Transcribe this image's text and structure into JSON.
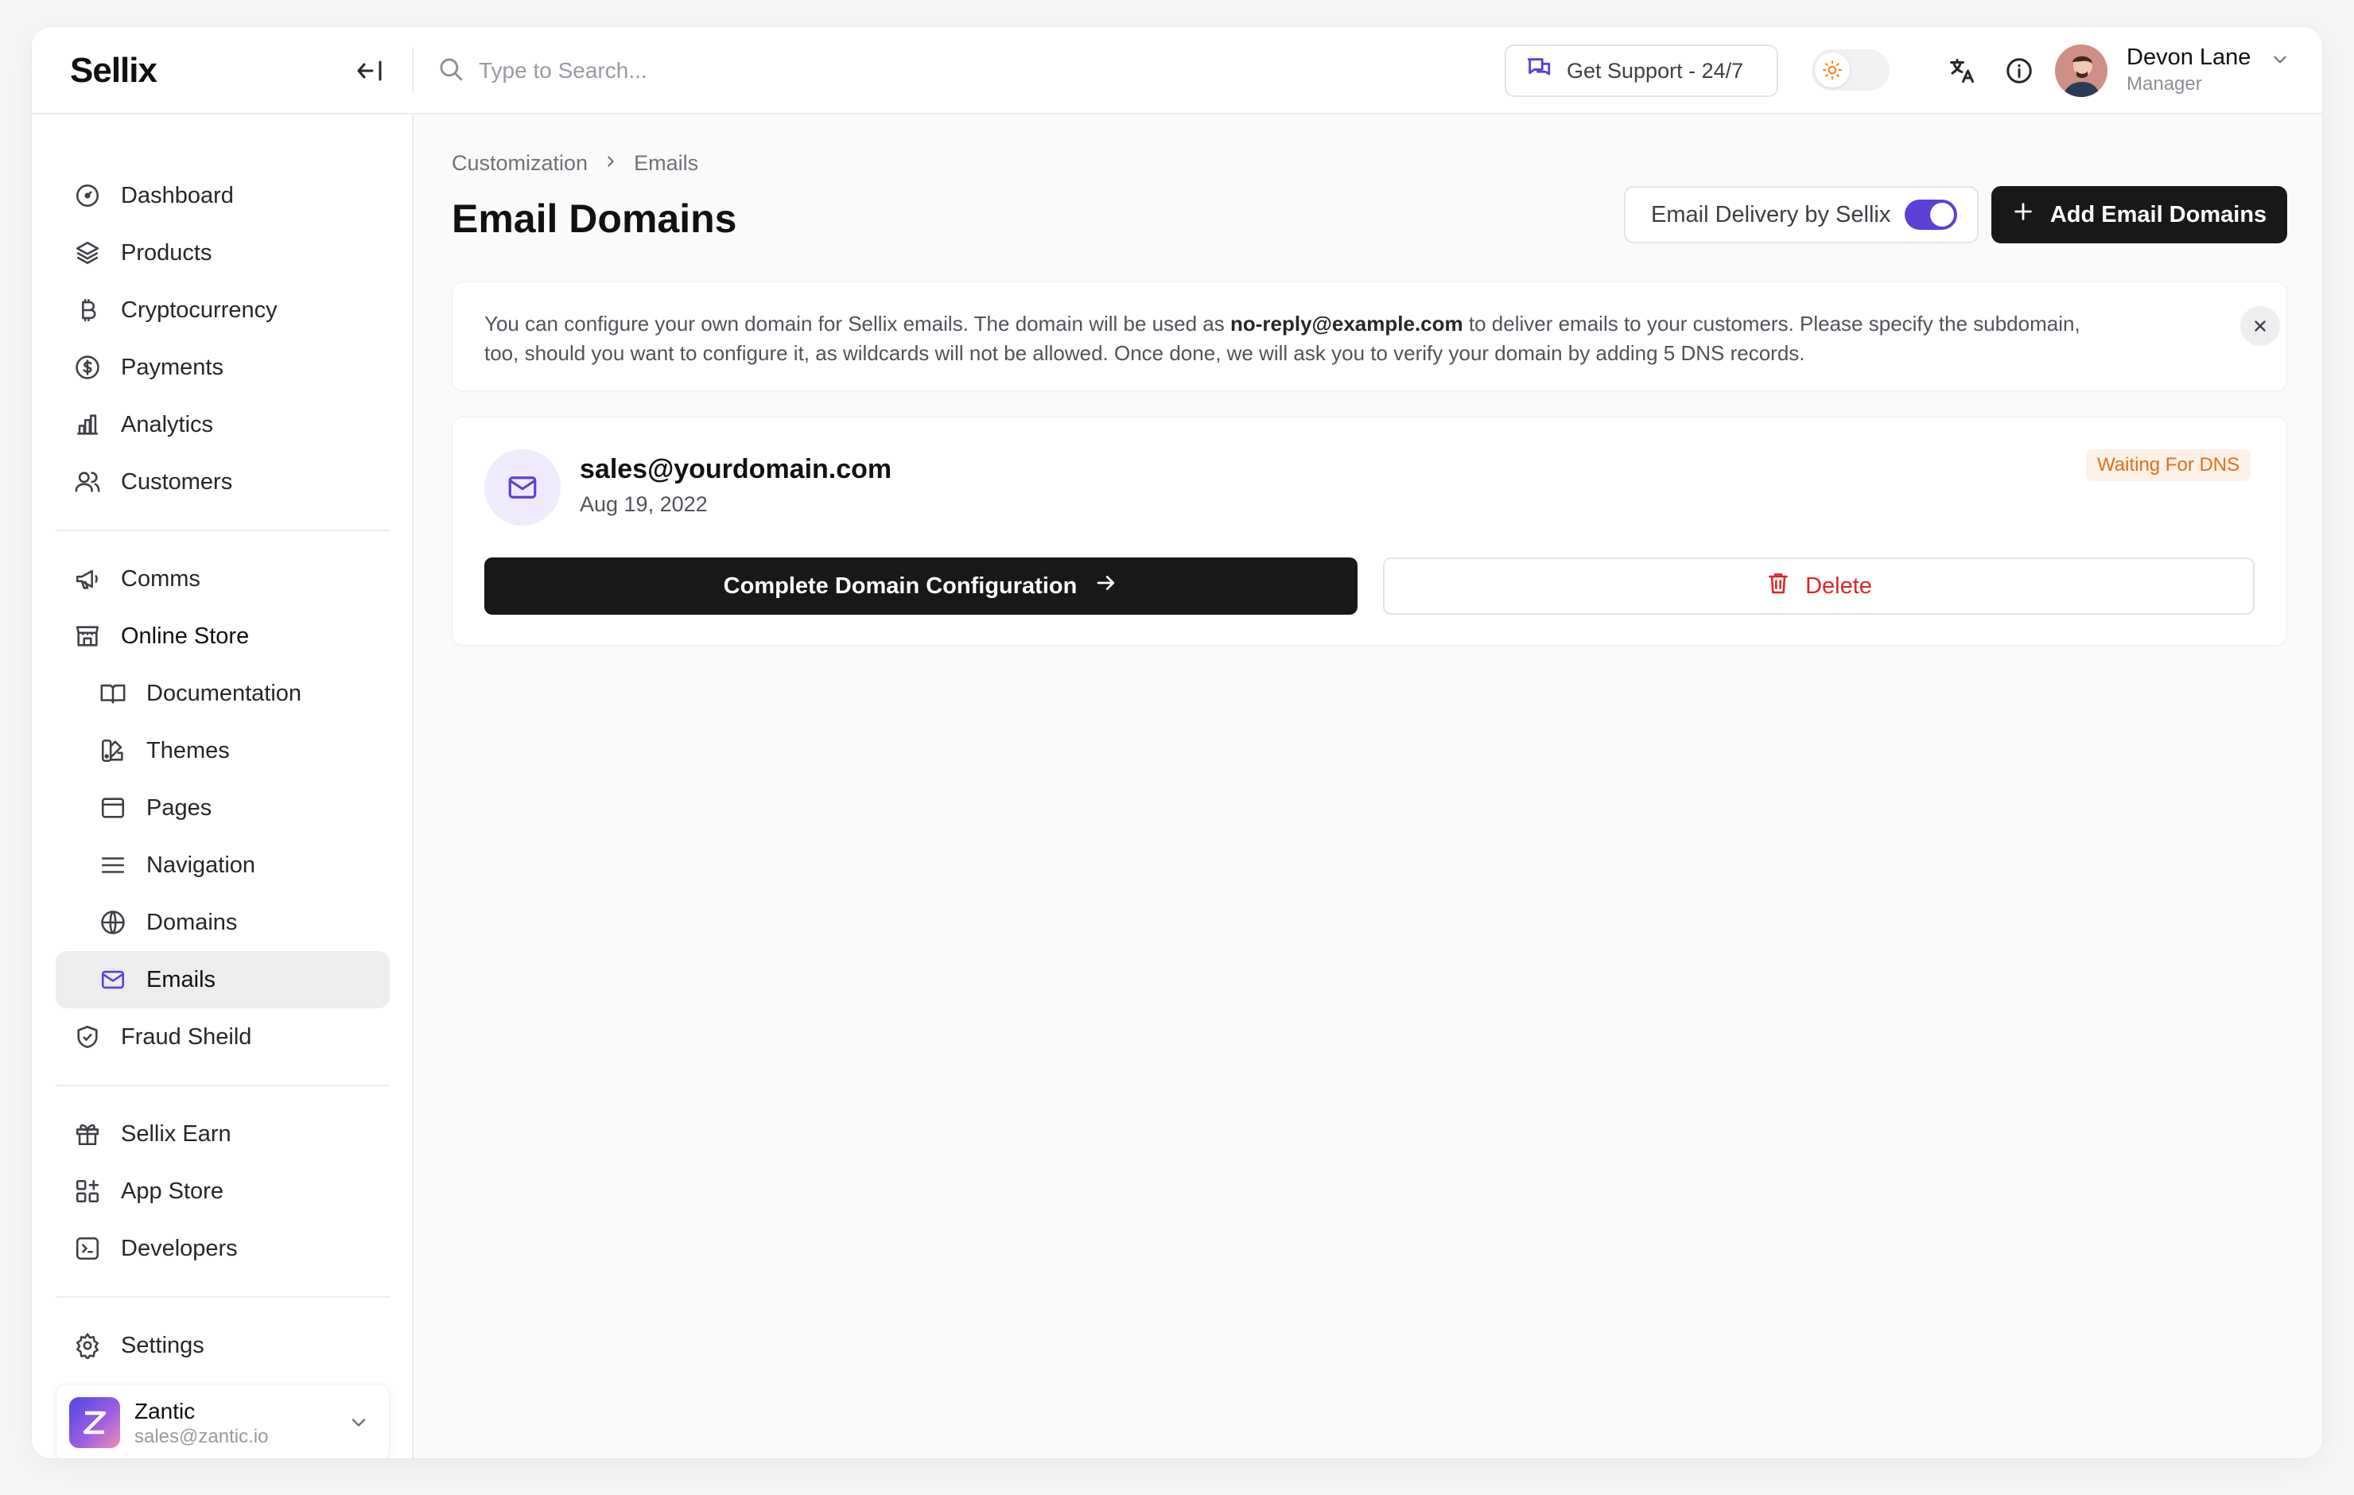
{
  "app": {
    "logo": "Sellix"
  },
  "topbar": {
    "search_placeholder": "Type to Search...",
    "support_label": "Get Support - 24/7",
    "user_name": "Devon Lane",
    "user_role": "Manager"
  },
  "sidebar": {
    "group1": [
      {
        "label": "Dashboard",
        "icon": "dashboard-icon"
      },
      {
        "label": "Products",
        "icon": "layers-icon"
      },
      {
        "label": "Cryptocurrency",
        "icon": "bitcoin-icon"
      },
      {
        "label": "Payments",
        "icon": "dollar-circle-icon"
      },
      {
        "label": "Analytics",
        "icon": "bar-chart-icon"
      },
      {
        "label": "Customers",
        "icon": "users-icon"
      }
    ],
    "group2": [
      {
        "label": "Comms",
        "icon": "megaphone-icon"
      },
      {
        "label": "Online Store",
        "icon": "store-icon"
      },
      {
        "label": "Documentation",
        "icon": "book-icon"
      },
      {
        "label": "Themes",
        "icon": "swatches-icon"
      },
      {
        "label": "Pages",
        "icon": "browser-icon"
      },
      {
        "label": "Navigation",
        "icon": "menu-icon"
      },
      {
        "label": "Domains",
        "icon": "globe-icon"
      },
      {
        "label": "Emails",
        "icon": "mail-icon",
        "active": true
      },
      {
        "label": "Fraud Sheild",
        "icon": "shield-check-icon"
      }
    ],
    "group3": [
      {
        "label": "Sellix Earn",
        "icon": "gift-icon"
      },
      {
        "label": "App Store",
        "icon": "apps-icon"
      },
      {
        "label": "Developers",
        "icon": "terminal-icon"
      }
    ],
    "settings_label": "Settings",
    "store": {
      "name": "Zantic",
      "email": "sales@zantic.io"
    }
  },
  "breadcrumb": {
    "parent": "Customization",
    "current": "Emails"
  },
  "page": {
    "title": "Email Domains",
    "delivery_label": "Email Delivery by Sellix",
    "delivery_enabled": true,
    "add_button": "Add Email Domains"
  },
  "info": {
    "text_before": "You can configure your own domain for Sellix emails. The domain will be used as ",
    "text_bold": "no-reply@example.com",
    "text_after": " to deliver emails to your customers. Please specify the subdomain, too, should you want to configure it, as wildcards will not be allowed. Once done, we will ask you to verify your domain by adding 5 DNS records."
  },
  "domain": {
    "email": "sales@yourdomain.com",
    "date": "Aug 19, 2022",
    "status": "Waiting For DNS",
    "complete_label": "Complete Domain Configuration",
    "delete_label": "Delete"
  },
  "colors": {
    "accent": "#5b3fd6",
    "danger": "#dc2626",
    "warning": "#e0701f"
  }
}
